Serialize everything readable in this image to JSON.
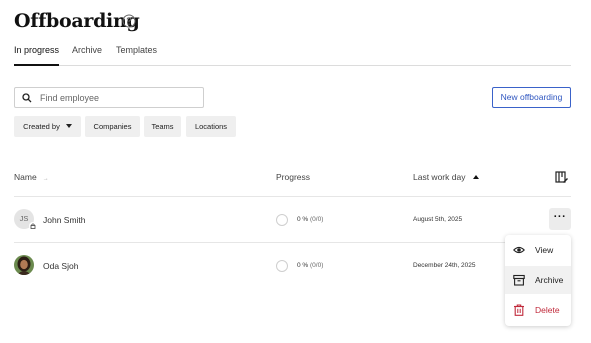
{
  "page": {
    "title": "Offboarding",
    "help_icon": "question-circle-icon"
  },
  "tabs": [
    {
      "label": "In progress",
      "active": true
    },
    {
      "label": "Archive",
      "active": false
    },
    {
      "label": "Templates",
      "active": false
    }
  ],
  "search": {
    "placeholder": "Find employee",
    "value": "",
    "icon": "search-icon"
  },
  "actions": {
    "new_label": "New offboarding"
  },
  "filters": [
    {
      "label": "Created by",
      "dropdown": true
    },
    {
      "label": "Companies"
    },
    {
      "label": "Teams"
    },
    {
      "label": "Locations"
    }
  ],
  "table": {
    "columns": {
      "name": "Name",
      "progress": "Progress",
      "last_work_day": "Last work day"
    },
    "settings_icon": "column-settings-icon",
    "rows": [
      {
        "initials": "JS",
        "name": "John Smith",
        "progress": "0 %",
        "progress_detail": "(0/0)",
        "last_work_day": "August 5th, 2025",
        "avatar": "initials",
        "badge_icon": "lock-icon"
      },
      {
        "initials": "",
        "name": "Oda Sjoh",
        "progress": "0 %",
        "progress_detail": "(0/0)",
        "last_work_day": "December 24th, 2025",
        "avatar": "photo"
      }
    ]
  },
  "row_menu": {
    "items": [
      {
        "label": "View",
        "icon": "eye-icon"
      },
      {
        "label": "Archive",
        "icon": "archive-box-icon"
      },
      {
        "label": "Delete",
        "icon": "trash-icon",
        "danger": true
      }
    ]
  },
  "colors": {
    "accent": "#2f56c0",
    "danger": "#c0293a",
    "chip_bg": "#efefef"
  }
}
